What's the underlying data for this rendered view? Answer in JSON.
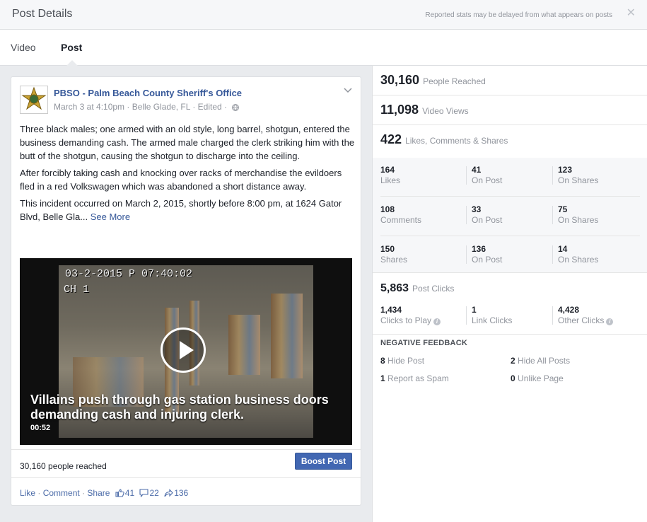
{
  "header": {
    "title": "Post Details",
    "note": "Reported stats may be delayed from what appears on posts",
    "close_glyph": "✕"
  },
  "tabs": [
    {
      "label": "Video",
      "active": false
    },
    {
      "label": "Post",
      "active": true
    }
  ],
  "post": {
    "page_name": "PBSO - Palm Beach County Sheriff's Office",
    "meta": "March 3 at 4:10pm · Belle Glade, FL · Edited ·",
    "paragraphs": [
      "Three black males; one armed with an old style, long barrel, shotgun, entered the business demanding cash. The armed male charged the clerk striking him with the butt of the shotgun, causing the shotgun to discharge into the ceiling.",
      "After forcibly taking cash and knocking over racks of merchandise the evildoers fled in a red Volkswagen which was abandoned a short distance away.",
      "This incident occurred on March 2, 2015, shortly before 8:00 pm, at 1624 Gator Blvd, Belle Gla..."
    ],
    "see_more": "See More",
    "video": {
      "timestamp": "03-2-2015 P 07:40:02",
      "channel": "CH 1",
      "title": "Villains push through gas station business doors demanding cash and injuring clerk.",
      "duration": "00:52"
    },
    "reached_text": "30,160 people reached",
    "boost_label": "Boost Post",
    "actions": {
      "like": "Like",
      "comment": "Comment",
      "share": "Share",
      "like_count": "41",
      "comment_count": "22",
      "share_count": "136",
      "sep": "·"
    }
  },
  "stats": {
    "reached": {
      "value": "30,160",
      "label": "People Reached"
    },
    "views": {
      "value": "11,098",
      "label": "Video Views"
    },
    "engagement": {
      "value": "422",
      "label": "Likes, Comments & Shares"
    },
    "grid": [
      [
        {
          "num": "164",
          "lbl": "Likes"
        },
        {
          "num": "41",
          "lbl": "On Post"
        },
        {
          "num": "123",
          "lbl": "On Shares"
        }
      ],
      [
        {
          "num": "108",
          "lbl": "Comments"
        },
        {
          "num": "33",
          "lbl": "On Post"
        },
        {
          "num": "75",
          "lbl": "On Shares"
        }
      ],
      [
        {
          "num": "150",
          "lbl": "Shares"
        },
        {
          "num": "136",
          "lbl": "On Post"
        },
        {
          "num": "14",
          "lbl": "On Shares"
        }
      ]
    ],
    "clicks": {
      "value": "5,863",
      "label": "Post Clicks"
    },
    "click_breakdown": [
      {
        "num": "1,434",
        "lbl": "Clicks to Play"
      },
      {
        "num": "1",
        "lbl": "Link Clicks"
      },
      {
        "num": "4,428",
        "lbl": "Other Clicks"
      }
    ],
    "negative": {
      "title": "NEGATIVE FEEDBACK",
      "items": [
        {
          "num": "8",
          "lbl": "Hide Post"
        },
        {
          "num": "2",
          "lbl": "Hide All Posts"
        },
        {
          "num": "1",
          "lbl": "Report as Spam"
        },
        {
          "num": "0",
          "lbl": "Unlike Page"
        }
      ]
    }
  },
  "colors": {
    "link": "#365899",
    "boost": "#4267b2",
    "muted": "#90949c"
  }
}
